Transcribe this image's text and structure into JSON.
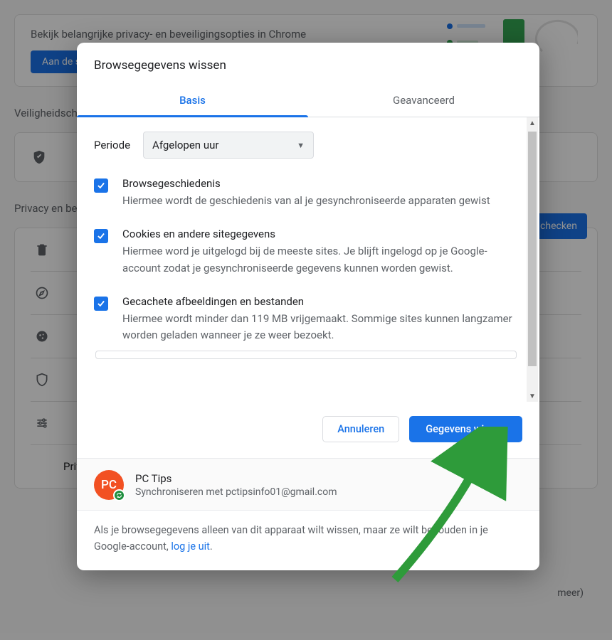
{
  "bg": {
    "topcard_text": "Bekijk belangrijke privacy- en beveiligingsopties in Chrome",
    "topcard_btn": "Aan de slag",
    "check_heading": "Veiligheidscheck",
    "check_btn": "Nu checken",
    "privacy_heading": "Privacy en beveiliging",
    "more": "meer)",
    "sandbox": "Privacy Sandbox"
  },
  "dialog": {
    "title": "Browsegegevens wissen",
    "tabs": {
      "basic": "Basis",
      "advanced": "Geavanceerd"
    },
    "period": {
      "label": "Periode",
      "value": "Afgelopen uur"
    },
    "options": [
      {
        "title": "Browsegeschiedenis",
        "desc": "Hiermee wordt de geschiedenis van al je gesynchroniseerde apparaten gewist"
      },
      {
        "title": "Cookies en andere sitegegevens",
        "desc": "Hiermee word je uitgelogd bij de meeste sites. Je blijft ingelogd op je Google-account zodat je gesynchroniseerde gegevens kunnen worden gewist."
      },
      {
        "title": "Gecachete afbeeldingen en bestanden",
        "desc": "Hiermee wordt minder dan 119 MB vrijgemaakt. Sommige sites kunnen langzamer worden geladen wanneer je ze weer bezoekt."
      }
    ],
    "cancel": "Annuleren",
    "confirm": "Gegevens wissen",
    "account": {
      "initials": "PC",
      "name": "PC Tips",
      "sync_prefix": "Synchroniseren met ",
      "email": "pctipsinfo01@gmail.com"
    },
    "footnote": {
      "pre": "Als je browsegegevens alleen van dit apparaat wilt wissen, maar ze wilt behouden in je Google-account, ",
      "link": "log je uit",
      "post": "."
    }
  }
}
